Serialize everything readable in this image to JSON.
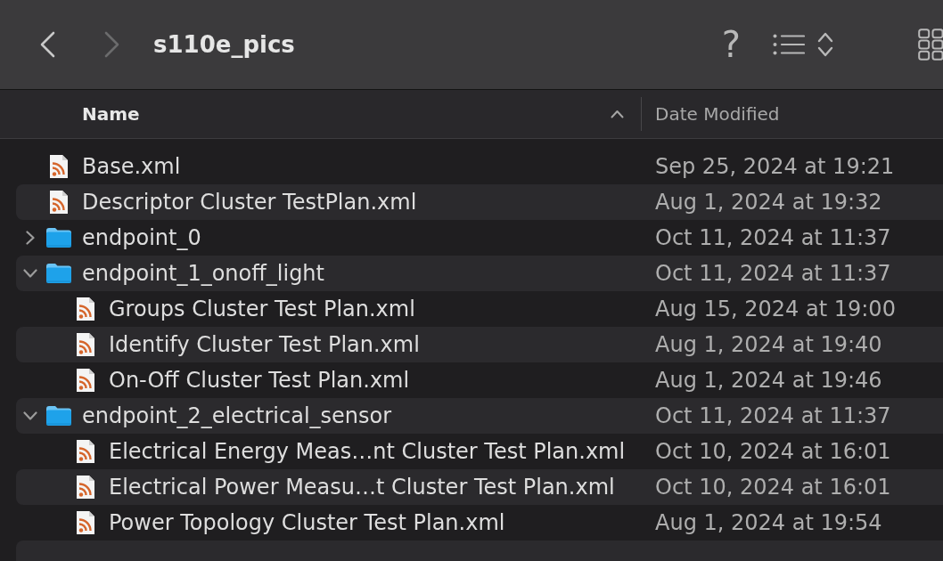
{
  "toolbar": {
    "nav_buttons": [
      {
        "kind": "back",
        "disabled": false
      },
      {
        "kind": "forward",
        "disabled": true
      }
    ],
    "title": "s110e_pics",
    "help": "?"
  },
  "columns": [
    {
      "label": "Name",
      "sorted": true
    },
    {
      "label": "Date Modified"
    }
  ],
  "rows": [
    {
      "kind": "file",
      "name": "Base.xml",
      "date_modified": "Sep 25, 2024 at 19:21"
    },
    {
      "kind": "file",
      "name": "Descriptor Cluster TestPlan.xml",
      "date_modified": "Aug 1, 2024 at 19:32"
    },
    {
      "kind": "folder",
      "name": "endpoint_0",
      "date_modified": "Oct 11, 2024 at 11:37",
      "expanded": false
    },
    {
      "kind": "folder",
      "name": "endpoint_1_onoff_light",
      "date_modified": "Oct 11, 2024 at 11:37",
      "expanded": true,
      "children": [
        {
          "kind": "file",
          "name": "Groups Cluster Test Plan.xml",
          "date_modified": "Aug 15, 2024 at 19:00"
        },
        {
          "kind": "file",
          "name": "Identify Cluster Test Plan.xml",
          "date_modified": "Aug 1, 2024 at 19:40"
        },
        {
          "kind": "file",
          "name": "On-Off Cluster Test Plan.xml",
          "date_modified": "Aug 1, 2024 at 19:46"
        }
      ]
    },
    {
      "kind": "folder",
      "name": "endpoint_2_electrical_sensor",
      "date_modified": "Oct 11, 2024 at 11:37",
      "expanded": true,
      "children": [
        {
          "kind": "file",
          "name": "Electrical Energy Meas…nt Cluster Test Plan.xml",
          "date_modified": "Oct 10, 2024 at 16:01"
        },
        {
          "kind": "file",
          "name": "Electrical Power Measu…t Cluster Test Plan.xml",
          "date_modified": "Oct 10, 2024 at 16:01"
        },
        {
          "kind": "file",
          "name": "Power Topology Cluster Test Plan.xml",
          "date_modified": "Aug 1, 2024 at 19:54"
        }
      ]
    }
  ]
}
